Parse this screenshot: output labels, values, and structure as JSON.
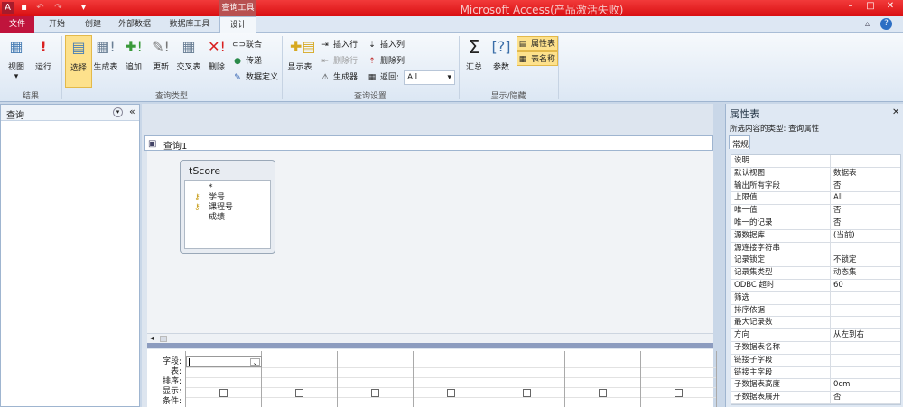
{
  "window": {
    "title": "Microsoft Access(产品激活失败)",
    "context_tab": "查询工具"
  },
  "tabs": [
    "文件",
    "开始",
    "创建",
    "外部数据",
    "数据库工具",
    "设计"
  ],
  "ribbon": {
    "results": {
      "label": "结果",
      "view": "视图",
      "run": "运行"
    },
    "query_type": {
      "label": "查询类型",
      "select": "选择",
      "make_table": "生成表",
      "append": "追加",
      "update": "更新",
      "crosstab": "交叉表",
      "delete": "删除",
      "union": "联合",
      "passthrough": "传递",
      "data_definition": "数据定义"
    },
    "query_setup": {
      "label": "查询设置",
      "show_table": "显示表",
      "insert_rows": "插入行",
      "delete_rows": "删除行",
      "builder": "生成器",
      "insert_columns": "插入列",
      "delete_columns": "删除列",
      "return_label": "返回:",
      "return_value": "All"
    },
    "show_hide": {
      "label": "显示/隐藏",
      "totals": "汇总",
      "parameters": "参数",
      "property_sheet": "属性表",
      "table_names": "表名称"
    }
  },
  "nav": {
    "title": "查询"
  },
  "query": {
    "tab": "查询1",
    "table": {
      "name": "tScore",
      "fields": [
        "*",
        "学号",
        "课程号",
        "成绩"
      ]
    }
  },
  "grid": {
    "row_labels": [
      "字段:",
      "表:",
      "排序:",
      "显示:",
      "条件:"
    ]
  },
  "property_sheet": {
    "title": "属性表",
    "selection_type": "所选内容的类型: 查询属性",
    "tab": "常规",
    "rows": [
      [
        "说明",
        ""
      ],
      [
        "默认视图",
        "数据表"
      ],
      [
        "输出所有字段",
        "否"
      ],
      [
        "上限值",
        "All"
      ],
      [
        "唯一值",
        "否"
      ],
      [
        "唯一的记录",
        "否"
      ],
      [
        "源数据库",
        "(当前)"
      ],
      [
        "源连接字符串",
        ""
      ],
      [
        "记录锁定",
        "不锁定"
      ],
      [
        "记录集类型",
        "动态集"
      ],
      [
        "ODBC 超时",
        "60"
      ],
      [
        "筛选",
        ""
      ],
      [
        "排序依据",
        ""
      ],
      [
        "最大记录数",
        ""
      ],
      [
        "方向",
        "从左到右"
      ],
      [
        "子数据表名称",
        ""
      ],
      [
        "链接子字段",
        ""
      ],
      [
        "链接主字段",
        ""
      ],
      [
        "子数据表高度",
        "0cm"
      ],
      [
        "子数据表展开",
        "否"
      ]
    ]
  }
}
